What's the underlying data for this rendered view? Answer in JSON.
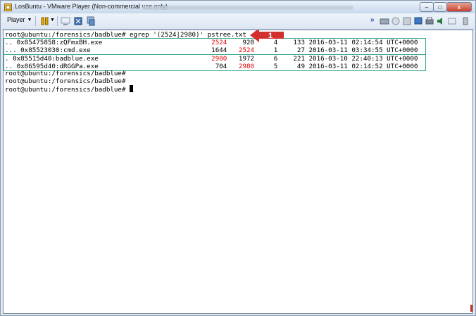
{
  "window": {
    "title": "LosBuntu - VMware Player (Non-commercial use only)",
    "controls": {
      "minimize": "–",
      "maximize": "□",
      "close": "x"
    }
  },
  "toolbar": {
    "player_label": "Player"
  },
  "terminal": {
    "command_prompt": "root@ubuntu:/forensics/badblue# ",
    "command": "egrep '(2524|2980)' pstree.txt",
    "rows": [
      {
        "name": ".. 0x85475858:zQFmxBH.exe",
        "pid": "2524",
        "ppid": "920",
        "thds": "4",
        "hnds": "133",
        "time": "2016-03-11 02:14:54 UTC+0000",
        "pid_red": true,
        "ppid_red": false
      },
      {
        "name": "... 0x85523030:cmd.exe",
        "pid": "1644",
        "ppid": "2524",
        "thds": "1",
        "hnds": "27",
        "time": "2016-03-11 03:34:55 UTC+0000",
        "pid_red": false,
        "ppid_red": true
      },
      {
        "name": ". 0x85515d40:badblue.exe",
        "pid": "2980",
        "ppid": "1972",
        "thds": "6",
        "hnds": "221",
        "time": "2016-03-10 22:40:13 UTC+0000",
        "pid_red": true,
        "ppid_red": false
      },
      {
        "name": ".. 0x86595d40:dRGGPa.exe",
        "pid": "704",
        "ppid": "2980",
        "thds": "5",
        "hnds": "49",
        "time": "2016-03-11 02:14:52 UTC+0000",
        "pid_red": false,
        "ppid_red": true
      }
    ],
    "prompts": [
      "root@ubuntu:/forensics/badblue#",
      "root@ubuntu:/forensics/badblue#",
      "root@ubuntu:/forensics/badblue# "
    ]
  },
  "annotation": {
    "label": "1"
  },
  "colors": {
    "highlight_red": "#e00000",
    "arrow_red": "#d32f2f",
    "row_box": "#3aa890"
  },
  "icons": [
    "vmware-icon",
    "pause-icon",
    "network-icon",
    "fullscreen-icon",
    "unity-icon",
    "forward-icon",
    "device-icons"
  ]
}
